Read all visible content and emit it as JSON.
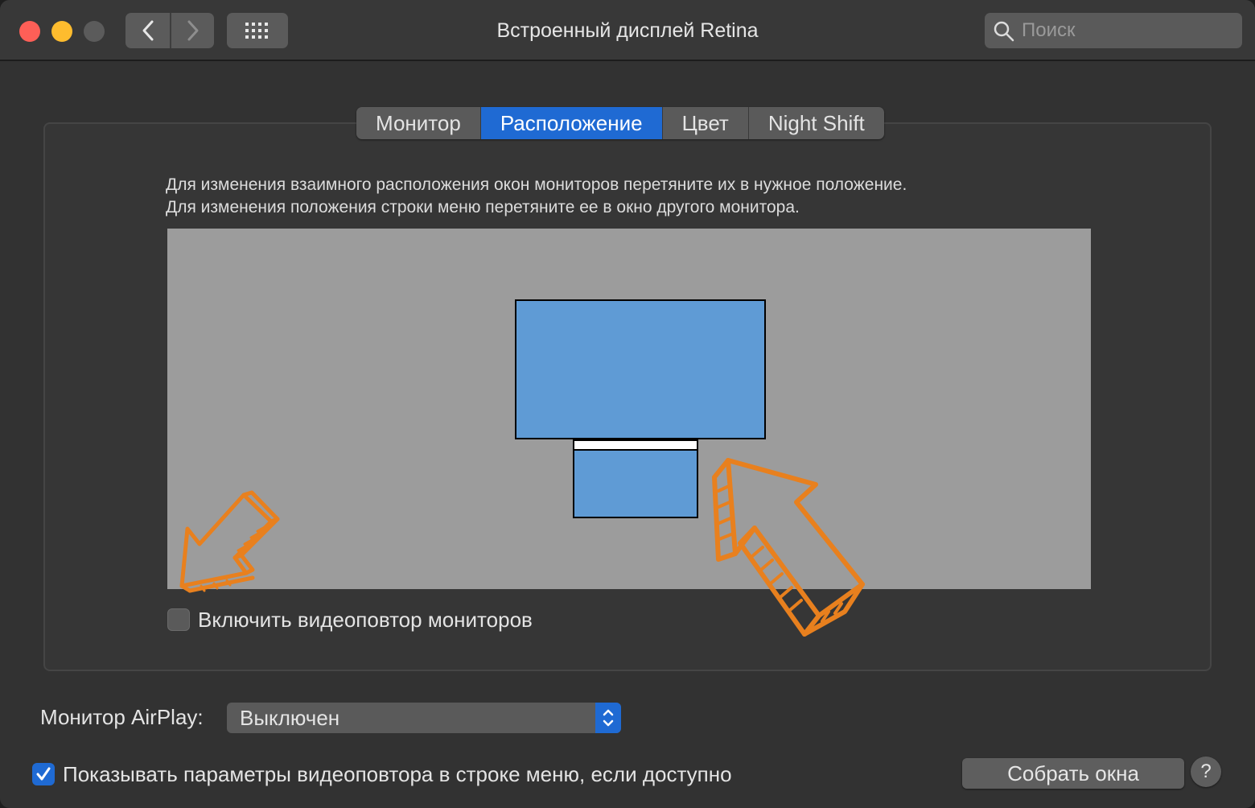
{
  "window": {
    "title": "Встроенный дисплей Retina"
  },
  "search": {
    "placeholder": "Поиск"
  },
  "tabs": [
    {
      "label": "Монитор",
      "active": false
    },
    {
      "label": "Расположение",
      "active": true
    },
    {
      "label": "Цвет",
      "active": false
    },
    {
      "label": "Night Shift",
      "active": false
    }
  ],
  "arrangement": {
    "description_line1": "Для изменения взаимного расположения окон мониторов перетяните их в нужное положение.",
    "description_line2": "Для изменения положения строки меню перетяните ее в окно другого монитора.",
    "mirror_label": "Включить видеоповтор мониторов",
    "mirror_checked": false
  },
  "airplay": {
    "label": "Монитор AirPlay:",
    "value": "Выключен"
  },
  "footer": {
    "show_options_label": "Показывать параметры видеоповтора в строке меню, если доступно",
    "show_options_checked": true,
    "gather_button": "Собрать окна",
    "help_button": "?"
  },
  "colors": {
    "accent": "#1f6ad3",
    "display_blue": "#5f9bd5",
    "annotation_orange": "#e8801e"
  }
}
